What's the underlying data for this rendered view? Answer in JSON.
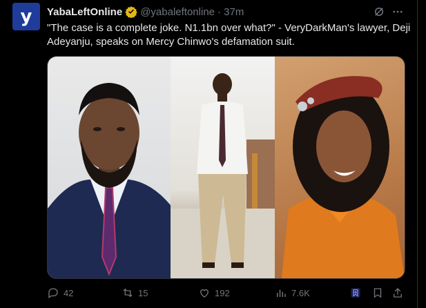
{
  "author": {
    "avatar_letter": "y",
    "name": "YabaLeftOnline",
    "handle": "@yabaleftonline",
    "time": "· 37m",
    "verified_color": "#e2b719"
  },
  "tweet": {
    "text": "\"The case is a complete joke. N1.1bn over what?\" - VeryDarkMan's lawyer, Deji Adeyanju, speaks on Mercy Chinwo's defamation suit."
  },
  "actions": {
    "replies": "42",
    "retweets": "15",
    "likes": "192",
    "views": "7.6K"
  },
  "icons": [
    "grok-icon",
    "more-icon",
    "reply-icon",
    "retweet-icon",
    "like-icon",
    "views-icon",
    "bookmark-icon",
    "share-icon"
  ],
  "colors": {
    "background": "#000000",
    "text": "#e7e9ea",
    "muted": "#71767b",
    "accent": "#1d9bf0"
  }
}
